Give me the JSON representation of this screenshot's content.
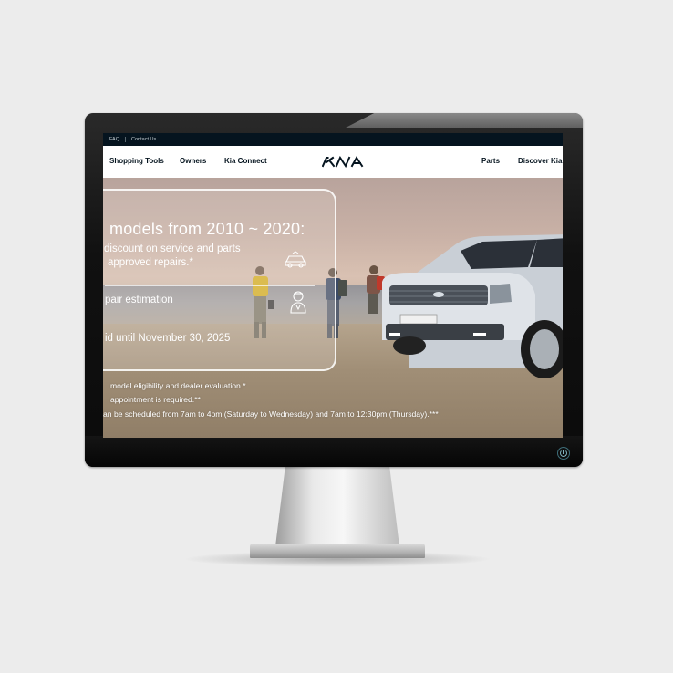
{
  "utility_bar": {
    "faq": "FAQ",
    "contact": "Contact Us"
  },
  "nav": {
    "shopping_tools": "Shopping Tools",
    "owners": "Owners",
    "kia_connect": "Kia Connect",
    "parts": "Parts",
    "discover": "Discover Kia"
  },
  "hero": {
    "title": "models from 2010 ~ 2020:",
    "line1": "discount on service and parts",
    "line2": "approved repairs.*",
    "line3": "pair estimation",
    "line4": "id until November 30, 2025",
    "note1": "model eligibility and dealer evaluation.*",
    "note2": "appointment is required.**",
    "note3": "an be scheduled from 7am to 4pm  (Saturday to Wednesday) and 7am to 12:30pm (Thursday).***"
  },
  "colors": {
    "brand_dark": "#05141f",
    "nav_bg": "#ffffff",
    "card_border": "#ffffff"
  },
  "icons": [
    "car-service-icon",
    "technician-icon",
    "power-icon",
    "kia-logo"
  ]
}
